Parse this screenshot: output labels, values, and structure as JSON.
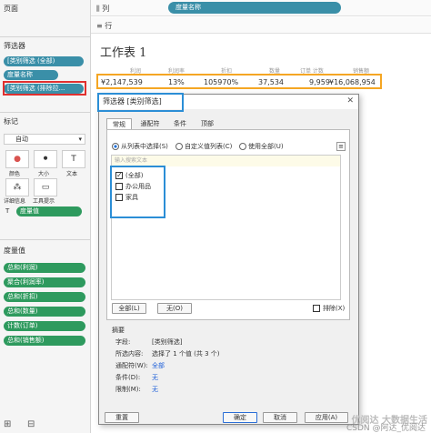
{
  "left_pane": {
    "pages_label": "页面",
    "filters_label": "筛选器",
    "filters": [
      "[类别筛选 (全部)",
      "度量名称",
      "[类别筛选 (排除拉..."
    ],
    "marks_label": "标记",
    "mark_type": "自动",
    "mark_buttons": [
      "颜色",
      "大小",
      "文本",
      "详细信息",
      "工具提示"
    ],
    "mark_measure_values": "度量值",
    "measure_values_label": "度量值",
    "measures": [
      "总和(利润)",
      "聚合(利润率)",
      "总和(折扣)",
      "总和(数量)",
      "计数(订单)",
      "总和(销售额)"
    ]
  },
  "shelves": {
    "columns_label": "列",
    "columns_pill": "度量名称",
    "rows_label": "行"
  },
  "worksheet": {
    "title": "工作表 1",
    "headers": [
      "利润",
      "利润率",
      "折扣",
      "数量",
      "订单 计数",
      "销售额"
    ],
    "values": [
      "¥2,147,539",
      "13%",
      "105970%",
      "37,534",
      "9,959",
      "¥16,068,954"
    ]
  },
  "dialog": {
    "title": "筛选器 [类别筛选]",
    "tabs": [
      "常规",
      "通配符",
      "条件",
      "顶部"
    ],
    "radio_list": "从列表中选择(S)",
    "radio_custom": "自定义值列表(C)",
    "radio_all": "使用全部(U)",
    "search_placeholder": "输入搜索文本",
    "items": [
      {
        "label": "(全部)",
        "checked": true
      },
      {
        "label": "办公用品",
        "checked": false
      },
      {
        "label": "家具",
        "checked": false
      }
    ],
    "btn_all": "全部(L)",
    "btn_none": "无(O)",
    "exclude_label": "排除(X)",
    "summary_title": "摘要",
    "summary": [
      {
        "k": "字段:",
        "v": "[类别筛选]",
        "blue": false
      },
      {
        "k": "所选内容:",
        "v": "选择了 1 个值 (共 3 个)",
        "blue": false
      },
      {
        "k": "通配符(W):",
        "v": "全部",
        "blue": true
      },
      {
        "k": "条件(D):",
        "v": "无",
        "blue": true
      },
      {
        "k": "限制(M):",
        "v": "无",
        "blue": true
      }
    ],
    "btn_reset": "重置",
    "btn_ok": "确定",
    "btn_cancel": "取消",
    "btn_apply": "应用(A)"
  },
  "watermark": "优阅达 大数据生活",
  "csdn": "CSDN @阿达_优阅达"
}
